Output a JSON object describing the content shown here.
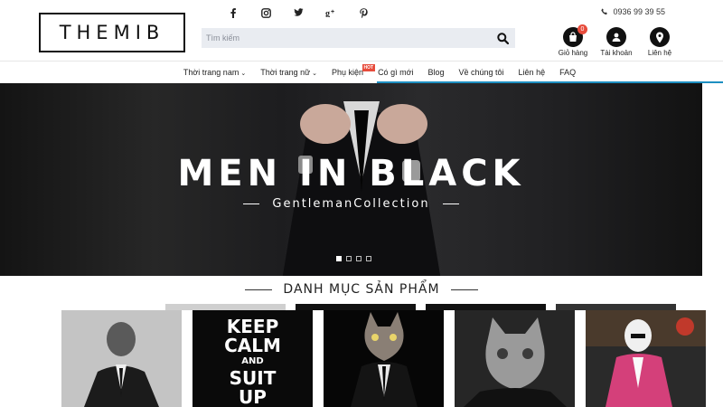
{
  "brand": {
    "logo_text": "THEMIB"
  },
  "social": [
    {
      "name": "facebook-icon",
      "glyph": "f"
    },
    {
      "name": "instagram-icon",
      "glyph": "◎"
    },
    {
      "name": "twitter-icon",
      "glyph": "🐦"
    },
    {
      "name": "google-plus-icon",
      "glyph": "g+"
    },
    {
      "name": "pinterest-icon",
      "glyph": "p"
    }
  ],
  "header": {
    "phone": "0936 99 39 55",
    "search_placeholder": "Tìm kiếm",
    "actions": [
      {
        "label": "Giỏ hàng",
        "badge": "0"
      },
      {
        "label": "Tài khoản"
      },
      {
        "label": "Liên hệ"
      }
    ]
  },
  "nav": {
    "items": [
      "Thời trang nam",
      "Thời trang nữ",
      "Phụ kiện",
      "Có gì mới",
      "Blog",
      "Về chúng tôi",
      "Liên hệ",
      "FAQ"
    ],
    "hot_badge": "HOT"
  },
  "hero": {
    "title": "MEN IN BLACK",
    "subtitle": "GentlemanCollection",
    "slides": 4,
    "active_slide": 1
  },
  "section": {
    "title": "DANH MỤC SẢN PHẨM"
  },
  "products": {
    "keep_calm": {
      "line1": "KEEP",
      "line2": "CALM",
      "line3": "AND",
      "line4": "SUIT",
      "line5": "UP"
    }
  },
  "colors": {
    "accent": "#1e8fc1",
    "badge": "#e74c3c",
    "dark": "#111111"
  }
}
